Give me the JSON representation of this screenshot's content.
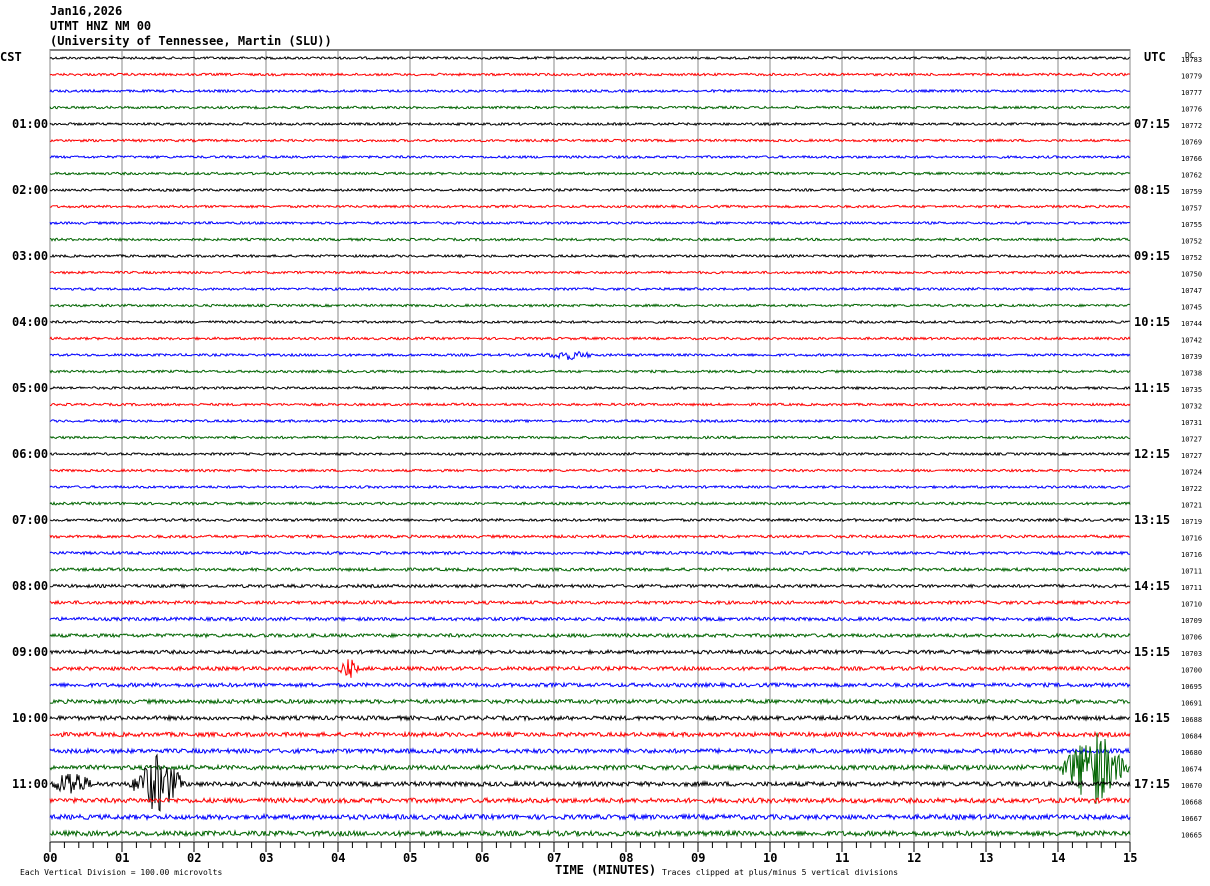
{
  "header": {
    "date": "Jan16,2026",
    "station": "UTMT HNZ NM 00",
    "network": "(University of Tennessee, Martin (SLU))"
  },
  "chart_data": {
    "type": "line",
    "subtype": "helicorder",
    "left_axis_title": "CST",
    "right_axis_title": "UTC",
    "dc_title": "DC",
    "xlabel": "TIME (MINUTES)",
    "x_ticks": [
      "00",
      "01",
      "02",
      "03",
      "04",
      "05",
      "06",
      "07",
      "08",
      "09",
      "10",
      "11",
      "12",
      "13",
      "14",
      "15"
    ],
    "xlim": [
      0,
      15
    ],
    "grid": true,
    "left_labels": [
      "01:00",
      "02:00",
      "03:00",
      "04:00",
      "05:00",
      "06:00",
      "07:00",
      "08:00",
      "09:00",
      "10:00",
      "11:00"
    ],
    "right_labels": [
      "07:15",
      "08:15",
      "09:15",
      "10:15",
      "11:15",
      "12:15",
      "13:15",
      "14:15",
      "15:15",
      "16:15",
      "17:15"
    ],
    "trace_colors": [
      "#000000",
      "#ff0000",
      "#0000ff",
      "#006400"
    ],
    "dc_values": [
      "10783",
      "10779",
      "10777",
      "10776",
      "10772",
      "10769",
      "10766",
      "10762",
      "10759",
      "10757",
      "10755",
      "10752",
      "10752",
      "10750",
      "10747",
      "10745",
      "10744",
      "10742",
      "10739",
      "10738",
      "10735",
      "10732",
      "10731",
      "10727",
      "10727",
      "10724",
      "10722",
      "10721",
      "10719",
      "10716",
      "10716",
      "10711",
      "10711",
      "10710",
      "10709",
      "10706",
      "10703",
      "10700",
      "10695",
      "10691",
      "10688",
      "10684",
      "10680",
      "10674",
      "10670",
      "10668",
      "10667",
      "10665"
    ],
    "events": [
      {
        "trace": 44,
        "start_min": 0.0,
        "end_min": 0.6,
        "amplitude": 14
      },
      {
        "trace": 44,
        "start_min": 1.1,
        "end_min": 1.9,
        "amplitude": 30
      },
      {
        "trace": 43,
        "start_min": 14.0,
        "end_min": 15.0,
        "amplitude": 40
      },
      {
        "trace": 37,
        "start_min": 4.0,
        "end_min": 4.3,
        "amplitude": 10
      },
      {
        "trace": 18,
        "start_min": 6.8,
        "end_min": 7.6,
        "amplitude": 4
      }
    ],
    "footer_left": "Each Vertical Division =  100.00 microvolts",
    "footer_right": "Traces clipped at plus/minus 5 vertical divisions"
  }
}
